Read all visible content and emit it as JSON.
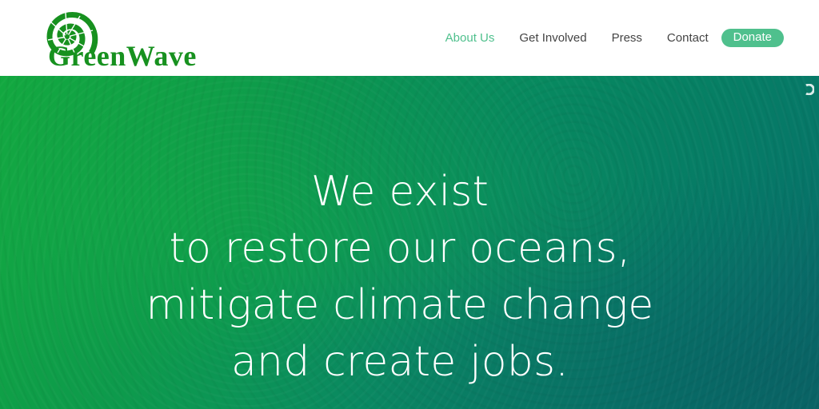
{
  "brand": {
    "name": "GreenWave",
    "logo_icon": "nautilus-shell-icon",
    "color": "#17911f"
  },
  "nav": {
    "items": [
      {
        "label": "About Us",
        "active": true
      },
      {
        "label": "Get Involved",
        "active": false
      },
      {
        "label": "Press",
        "active": false
      },
      {
        "label": "Contact",
        "active": false
      }
    ],
    "donate_label": "Donate",
    "accent": "#4fc08d"
  },
  "hero": {
    "lines": [
      "We exist",
      "to restore our oceans,",
      "mitigate climate change",
      "and create jobs."
    ],
    "slider_icon": "chevron-right-icon"
  }
}
